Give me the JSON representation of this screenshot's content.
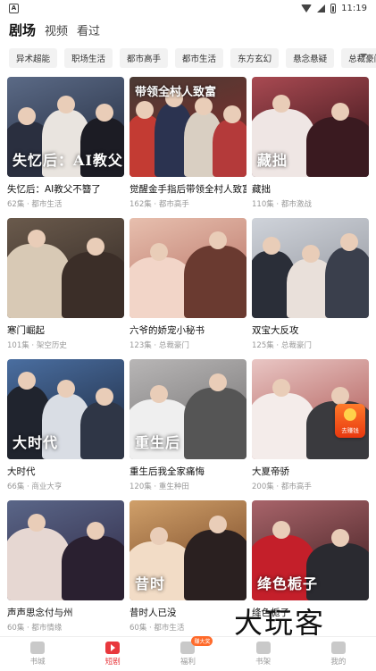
{
  "status_bar": {
    "time": "11:19",
    "notif_icon": "notification-box-icon"
  },
  "top_nav": {
    "tabs": [
      "剧场",
      "视频",
      "看过"
    ]
  },
  "chips": [
    "异术超能",
    "职场生活",
    "都市高手",
    "都市生活",
    "东方玄幻",
    "悬念悬疑",
    "总裁豪门"
  ],
  "cards": [
    {
      "title": "失忆后：AI教父不簪了",
      "meta": "62集 · 都市生活",
      "poster_text": "失忆后：AI教父",
      "poster_text_pos": "bottom",
      "bg": [
        "#5b6a86",
        "#1e2638"
      ],
      "figs": [
        "#2a2f3f",
        "#e9e4df",
        "#1c1c24"
      ]
    },
    {
      "title": "觉醒金手指后带领全村人致富",
      "meta": "162集 · 都市高手",
      "poster_text": "带领全村人致富",
      "poster_text_pos": "top",
      "bg": [
        "#4a3a34",
        "#8a2c2a"
      ],
      "figs": [
        "#c33b33",
        "#2b3350",
        "#d9cfc2",
        "#b43a3a"
      ]
    },
    {
      "title": "藏拙",
      "meta": "110集 · 都市激战",
      "poster_text": "藏拙",
      "poster_text_pos": "bottom",
      "bg": [
        "#a94a52",
        "#2a0d12"
      ],
      "figs": [
        "#efe6e4",
        "#3a1a20"
      ]
    },
    {
      "title": "寒门崛起",
      "meta": "101集 · 架空历史",
      "poster_text": "",
      "poster_text_pos": "bottom",
      "bg": [
        "#6a5a4c",
        "#2d2420"
      ],
      "figs": [
        "#d8c9b5",
        "#3b2e28"
      ]
    },
    {
      "title": "六爷的娇宠小秘书",
      "meta": "123集 · 总裁豪门",
      "poster_text": "",
      "poster_text_pos": "bottom",
      "bg": [
        "#e7bfae",
        "#b2685c"
      ],
      "figs": [
        "#f2d5c8",
        "#6a3a30"
      ]
    },
    {
      "title": "双宝大反攻",
      "meta": "125集 · 总裁豪门",
      "poster_text": "",
      "poster_text_pos": "bottom",
      "bg": [
        "#cfd3da",
        "#8b8e96"
      ],
      "figs": [
        "#2a2e38",
        "#e9e0da",
        "#3a3f4c"
      ]
    },
    {
      "title": "大时代",
      "meta": "66集 · 商业大亨",
      "poster_text": "大时代",
      "poster_text_pos": "bottom",
      "bg": [
        "#4a6ea0",
        "#1a2438"
      ],
      "figs": [
        "#20242e",
        "#d9dde4",
        "#2f3646"
      ]
    },
    {
      "title": "重生后我全家痛悔",
      "meta": "120集 · 重生种田",
      "poster_text": "重生后",
      "poster_text_pos": "bottom",
      "bg": [
        "#b8b6b6",
        "#6c6a6a"
      ],
      "figs": [
        "#efefef",
        "#555"
      ]
    },
    {
      "title": "大夏帝骄",
      "meta": "200集 · 都市高手",
      "poster_text": "",
      "poster_text_pos": "bottom",
      "bg": [
        "#e9c6c4",
        "#a74a46"
      ],
      "figs": [
        "#f4ecea",
        "#3a3a3e"
      ]
    },
    {
      "title": "声声思念付与州",
      "meta": "60集 · 都市情缘",
      "poster_text": "",
      "poster_text_pos": "bottom",
      "bg": [
        "#5a6688",
        "#2c2440"
      ],
      "figs": [
        "#e6d7d2",
        "#2a2030"
      ]
    },
    {
      "title": "昔时人已没",
      "meta": "60集 · 都市生活",
      "poster_text": "昔时",
      "poster_text_pos": "bottom",
      "bg": [
        "#d0a06a",
        "#6a3a1c"
      ],
      "figs": [
        "#f2dcc6",
        "#2a2020"
      ]
    },
    {
      "title": "绛色栀子",
      "meta": "",
      "poster_text": "绛色栀子",
      "poster_text_pos": "bottom",
      "bg": [
        "#a8646a",
        "#3a1a1c"
      ],
      "figs": [
        "#c41f2a",
        "#2a2a30"
      ]
    }
  ],
  "float_widget": {
    "label": "去赚钱",
    "icon": "red-packet-icon"
  },
  "bottom_nav": [
    {
      "label": "书城",
      "icon": "bookstore-icon",
      "active": false
    },
    {
      "label": "短剧",
      "icon": "short-drama-icon",
      "active": true
    },
    {
      "label": "福利",
      "icon": "gift-icon",
      "active": false,
      "badge": "赚大奖"
    },
    {
      "label": "书架",
      "icon": "bookshelf-icon",
      "active": false
    },
    {
      "label": "我的",
      "icon": "profile-icon",
      "active": false
    }
  ],
  "watermark": "大玩客",
  "colors": {
    "accent": "#e8383d",
    "chip_bg": "#f2f2f2"
  }
}
